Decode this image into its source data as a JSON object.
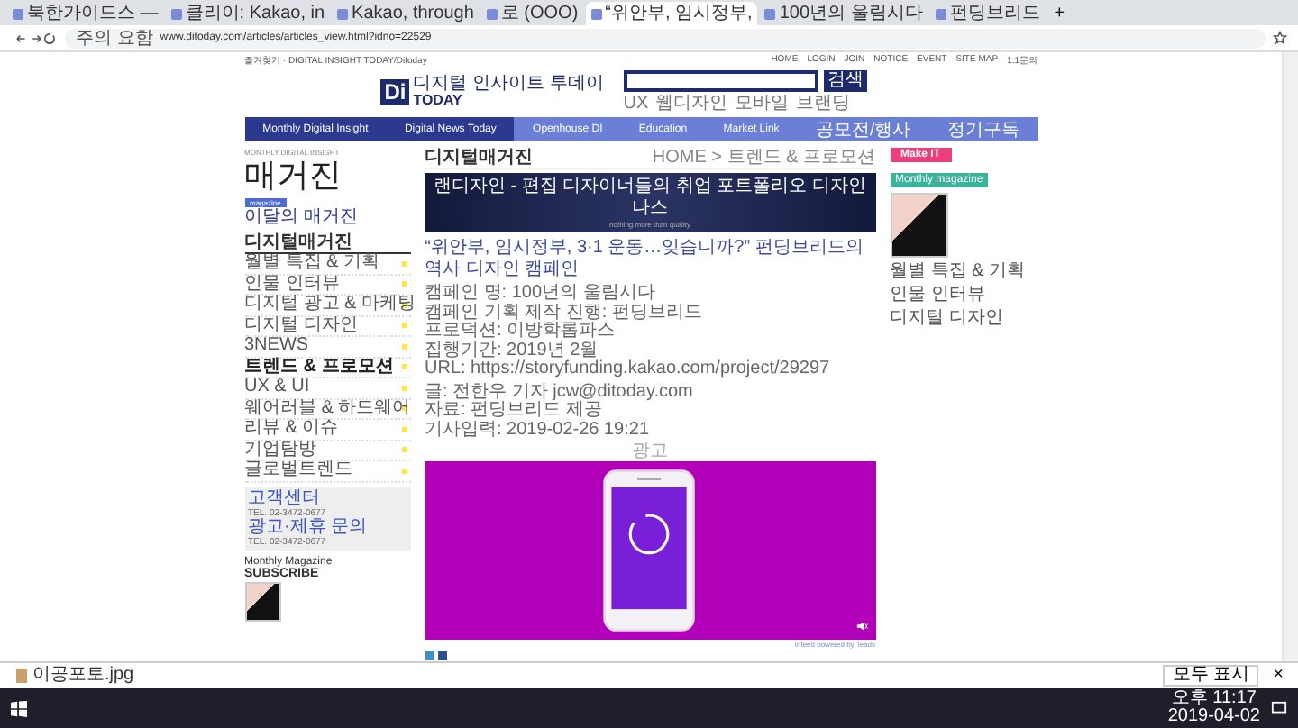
{
  "browser": {
    "tabs": [
      {
        "title": "북한가이드스 —",
        "selected": false
      },
      {
        "title": "클리이: Kakao, in",
        "selected": false
      },
      {
        "title": "Kakao, through",
        "selected": false
      },
      {
        "title": "로 (OOO)",
        "selected": false
      },
      {
        "title": "“위안부, 임시정부,",
        "selected": true
      },
      {
        "title": "100년의 울림시다",
        "selected": false
      },
      {
        "title": "펀딩브리드",
        "selected": false
      }
    ],
    "new_tab": "+",
    "address": {
      "security": "주의 요함",
      "url": "www.ditoday.com/articles/articles_view.html?idno=22529"
    }
  },
  "site": {
    "top_left": "즐겨찾기 · DIGITAL INSIGHT TODAY/Ditoday",
    "util_links": [
      "HOME",
      "LOGIN",
      "JOIN",
      "NOTICE",
      "EVENT",
      "SITE MAP",
      "1:1문의"
    ],
    "logo": {
      "mark": "Di",
      "tagline": "디지털 인사이트 투데이",
      "name": "TODAY"
    },
    "search": {
      "button": "검색",
      "keywords": [
        "UX",
        "웹디자인",
        "모바일",
        "브랜딩"
      ]
    },
    "nav": [
      {
        "label": "Monthly Digital Insight",
        "selected": true
      },
      {
        "label": "Digital News Today",
        "selected": true
      },
      {
        "label": "Openhouse DI",
        "selected": false
      },
      {
        "label": "Education",
        "selected": false
      },
      {
        "label": "Market Link",
        "selected": false
      },
      {
        "label": "공모전/행사",
        "selected": false
      },
      {
        "label": "정기구독",
        "selected": false
      }
    ]
  },
  "sidebar": {
    "eyebrow": "MONTHLY DIGITAL INSIGHT",
    "title": "매거진",
    "tag": "magazine",
    "current": "이달의 매거진",
    "menu_title": "디지털매거진",
    "items": [
      {
        "label": "월별 특집 & 기획",
        "selected": false
      },
      {
        "label": "인물 인터뷰",
        "selected": false
      },
      {
        "label": "디지털 광고 & 마케팅",
        "selected": false
      },
      {
        "label": "디지털 디자인",
        "selected": false
      },
      {
        "label": "3NEWS",
        "selected": false
      },
      {
        "label": "트렌드 & 프로모션",
        "selected": true
      },
      {
        "label": "UX & UI",
        "selected": false
      },
      {
        "label": "웨어러블 & 하드웨어",
        "selected": false
      },
      {
        "label": "리뷰 & 이슈",
        "selected": false
      },
      {
        "label": "기업탐방",
        "selected": false
      },
      {
        "label": "글로벌트렌드",
        "selected": false
      }
    ],
    "contacts": [
      {
        "title": "고객센터",
        "line": "TEL. 02-3472-0677"
      },
      {
        "title": "광고·제휴 문의",
        "line": "TEL. 02-3472-0677"
      }
    ],
    "subscribe": {
      "eyebrow": "Monthly Magazine",
      "title": "SUBSCRIBE"
    }
  },
  "article": {
    "section": "디지털매거진",
    "breadcrumb": "HOME > 트렌드 & 프로모션",
    "banner": {
      "headline": "랜디자인 - 편집 디자이너들의 취업 포트폴리오 디자인나스",
      "sub": "nothing more than quality"
    },
    "title": "“위안부, 임시정부, 3·1 운동…잊습니까?” 펀딩브리드의 역사 디자인 캠페인",
    "info": [
      "캠페인 명: 100년의 울림시다",
      "캠페인 기획 제작 진행: 펀딩브리드",
      "프로덕션: 이방학롭파스",
      "집행기간: 2019년 2월",
      "URL: https://storyfunding.kakao.com/project/29297"
    ],
    "byline": [
      "글: 전한우 기자 jcw@ditoday.com",
      "자료: 펀딩브리드 제공",
      "기사입력: 2019-02-26 19:21"
    ],
    "ad_label": "광고",
    "ad_credit": "Infeed powered by Teads"
  },
  "right": {
    "make_it": "Make IT",
    "monthly": "Monthly magazine",
    "items": [
      "월별 특집 & 기획",
      "인물 인터뷰",
      "디지털 디자인"
    ]
  },
  "downloads": {
    "file": "이공포토.jpg",
    "show_all": "모두 표시",
    "close": "×"
  },
  "taskbar": {
    "time": "오후 11:17",
    "date": "2019-04-02"
  }
}
